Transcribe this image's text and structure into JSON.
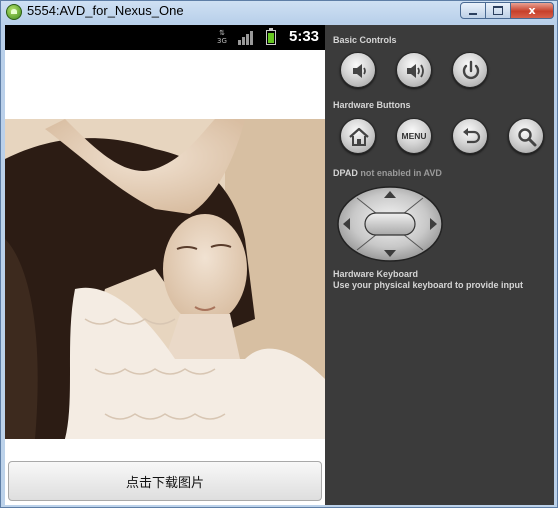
{
  "window": {
    "title": "5554:AVD_for_Nexus_One",
    "minimize_label": "",
    "maximize_label": "",
    "close_label": "x"
  },
  "status_bar": {
    "time": "5:33",
    "data_indicator": "3G"
  },
  "app": {
    "download_button_label": "点击下载图片"
  },
  "controls": {
    "basic_controls_label": "Basic Controls",
    "hardware_buttons_label": "Hardware Buttons",
    "menu_button_label": "MENU",
    "dpad_label": "DPAD",
    "dpad_note": "not enabled in AVD",
    "keyboard_label": "Hardware Keyboard",
    "keyboard_note": "Use your physical keyboard to provide input"
  },
  "colors": {
    "panel_bg": "#3b3b3b",
    "battery": "#67c722",
    "title_bar": "#bcd2ea"
  }
}
